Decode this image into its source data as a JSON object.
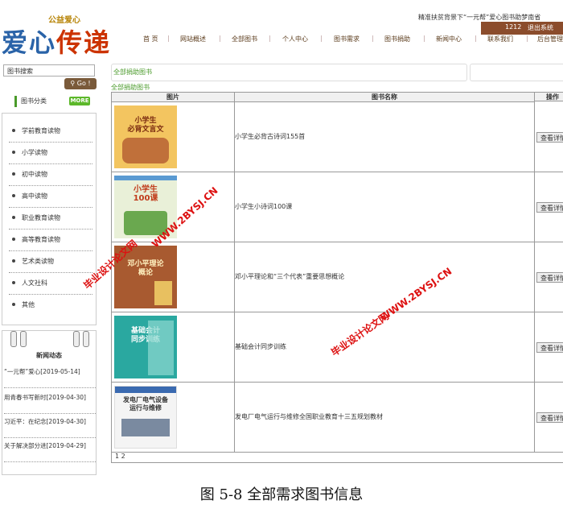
{
  "header": {
    "slogan": "公益爱心",
    "logo_a": "爱心",
    "logo_b": "传递",
    "notice": "精准扶贫背景下“一元帮”爱心图书助梦南省",
    "user": "1212",
    "logout": "退出系统",
    "nav": [
      "首 页",
      "网站概述",
      "全部图书",
      "个人中心",
      "图书需求",
      "图书捐助",
      "新闻中心",
      "联系我们",
      "后台管理"
    ]
  },
  "sidebar": {
    "search_placeholder": "图书搜索",
    "go_label": "Go !",
    "category_title": "图书分类",
    "more": "MORE",
    "categories": [
      "学前教育读物",
      "小学读物",
      "初中读物",
      "高中读物",
      "职业教育读物",
      "高等教育读物",
      "艺术类读物",
      "人文社科",
      "其他"
    ],
    "news_title": "新闻动态",
    "news": [
      "“一元帮”爱心[2019-05-14]",
      "用青春书写新时[2019-04-30]",
      "习近平：在纪念[2019-04-30]",
      "关于解决部分进[2019-04-29]"
    ]
  },
  "main": {
    "breadcrumb": "全部捐助图书",
    "subtitle": "全部捐助图书",
    "columns": [
      "图片",
      "图书名称",
      "操作"
    ],
    "rows": [
      {
        "name": "小学生必背古诗词155首",
        "cover": "小学生\n必背文言文"
      },
      {
        "name": "小学生小诗词100课",
        "cover": "小学生\n100课"
      },
      {
        "name": "邓小平理论和“三个代表”重要思想概论",
        "cover": "邓小平理论\n概论"
      },
      {
        "name": "基础会计同步训练",
        "cover": "基础会计\n同步训练"
      },
      {
        "name": "发电厂电气运行与维修全国职业教育十三五规划教材",
        "cover": "发电厂电气设备\n运行与维修"
      }
    ],
    "view_label": "查看详情",
    "pager": "1 2"
  },
  "watermarks": [
    "毕业设计论文网",
    "WWW.2BYSJ.CN"
  ],
  "caption": "图 5-8    全部需求图书信息"
}
